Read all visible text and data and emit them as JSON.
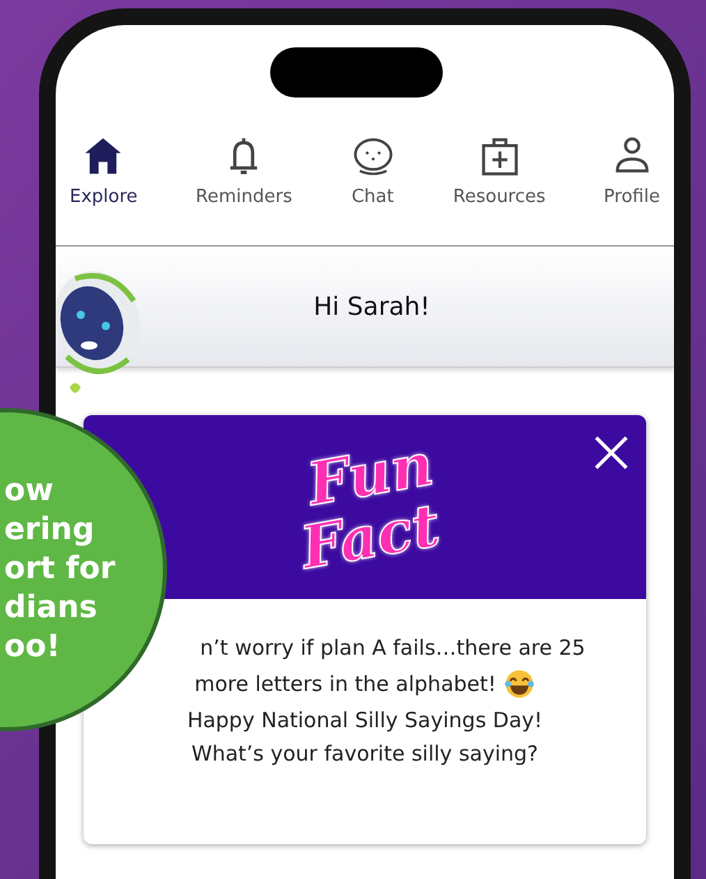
{
  "nav": [
    {
      "label": "Explore",
      "selected": true
    },
    {
      "label": "Reminders",
      "selected": false
    },
    {
      "label": "Chat",
      "selected": false
    },
    {
      "label": "Resources",
      "selected": false
    },
    {
      "label": "Profile",
      "selected": false
    }
  ],
  "greeting": "Hi Sarah!",
  "card": {
    "logo": [
      "Fun",
      "Fact"
    ],
    "lines": [
      {
        "text": "n’t worry if plan A fails…there are 25",
        "emoji": false
      },
      {
        "text": "more letters in the alphabet!",
        "emoji": true
      },
      {
        "text": "Happy National Silly Sayings Day!",
        "emoji": false
      },
      {
        "text": "What’s your favorite silly saying?",
        "emoji": false
      }
    ]
  },
  "badge": {
    "lines": [
      "ow",
      "ering",
      "ort for",
      "dians",
      "oo!"
    ]
  }
}
